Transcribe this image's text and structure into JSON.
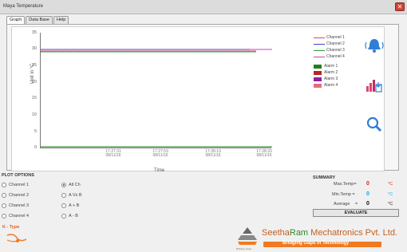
{
  "window": {
    "title": "Maya Temperature",
    "close": "✕"
  },
  "tabs": [
    "Graph",
    "Data Base",
    "Help"
  ],
  "graph": {
    "ylabel": "Unit in °C",
    "xlabel": "Time",
    "yticks": [
      "35",
      "30",
      "25",
      "20",
      "15",
      "10",
      "5",
      "0"
    ],
    "xticks": [
      {
        "t": "17:27:31",
        "d": "08/11/16"
      },
      {
        "t": "17:27:53",
        "d": "08/11/16"
      },
      {
        "t": "17:28:13",
        "d": "08/11/16"
      },
      {
        "t": "17:28:33",
        "d": "08/11/16"
      }
    ]
  },
  "legend": {
    "channels": [
      {
        "label": "Channel 1",
        "color": "#e04070"
      },
      {
        "label": "Channel 2",
        "color": "#4040d0"
      },
      {
        "label": "Channel 3",
        "color": "#30a030"
      },
      {
        "label": "Channel 4",
        "color": "#c040c0"
      }
    ],
    "alarms": [
      {
        "label": "Alarm 1",
        "color": "#208020"
      },
      {
        "label": "Alarm 2",
        "color": "#c02020"
      },
      {
        "label": "Alarm 3",
        "color": "#9020a0"
      },
      {
        "label": "Alarm 4",
        "color": "#e07080"
      }
    ]
  },
  "plot_options": {
    "title": "PLOT OPTIONS",
    "channels": [
      "Channel 1",
      "Channel 2",
      "Channel 3",
      "Channel 4"
    ],
    "modes": [
      "All Ch",
      "A Vs B",
      "A + B",
      "A - B"
    ],
    "selected_mode": "All Ch"
  },
  "summary": {
    "title": "SUMMARY",
    "max_label": "Max.Temp=",
    "max_value": "0",
    "min_label": "Min.Temp =",
    "min_value": "0",
    "avg_label": "Average",
    "avg_eq": "=",
    "avg_value": "0",
    "unit": "°C",
    "evaluate": "EVALUATE"
  },
  "ktype": {
    "label": "K - Type"
  },
  "brand": {
    "name_part1": "Seetha",
    "name_part2": "Ram",
    "name_part3": " Mechatronics Pvt. Ltd.",
    "tagline": "Bridging Gaps in Technology",
    "sub": "Bridging Gaps"
  },
  "colors": {
    "max_value": "#e02020",
    "min_value": "#20a0e0",
    "avg_value": "#111111",
    "accent": "#f07a20"
  },
  "icons": [
    "close-icon",
    "alarm-bell-icon",
    "chart-export-icon",
    "zoom-search-icon",
    "k-type-probe-icon",
    "company-logo-icon"
  ]
}
